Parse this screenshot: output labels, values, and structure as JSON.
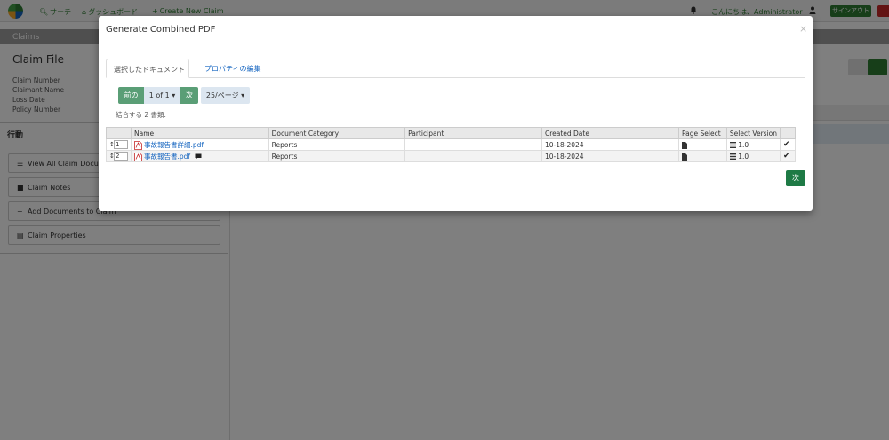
{
  "navbar": {
    "search": "サーチ",
    "dashboard": "ダッシュボード",
    "create_claim": "Create New Claim",
    "greeting": "こんにちは、Administrator",
    "signout": "サインアウト"
  },
  "page": {
    "section_title": "Claims",
    "claim_file_title": "Claim File",
    "fields": [
      "Claim Number",
      "Claimant Name",
      "Loss Date",
      "Policy Number"
    ],
    "actions_title": "行動",
    "actions": [
      {
        "label": "View All Claim Documents",
        "icon": "list-icon"
      },
      {
        "label": "Claim Notes",
        "icon": "comment-icon"
      },
      {
        "label": "Add Documents to Claim",
        "icon": "plus-icon"
      },
      {
        "label": "Claim Properties",
        "icon": "table-icon"
      }
    ]
  },
  "modal": {
    "title": "Generate Combined PDF",
    "close": "×",
    "tabs": [
      "選択したドキュメント",
      "プロパティの編集"
    ],
    "pager": {
      "prev": "前の",
      "count": "1 of 1",
      "next": "次",
      "page_size": "25/ページ"
    },
    "combine_note": "結合する 2 書類.",
    "table": {
      "columns": [
        "Name",
        "Document Category",
        "Participant",
        "Created Date",
        "Page Select",
        "Select Version"
      ],
      "rows": [
        {
          "order": "1",
          "name": "事故報告書詳細.pdf",
          "category": "Reports",
          "participant": "",
          "created": "10-18-2024",
          "version": "1.0",
          "has_comment": false
        },
        {
          "order": "2",
          "name": "事故報告書.pdf",
          "category": "Reports",
          "participant": "",
          "created": "10-18-2024",
          "version": "1.0",
          "has_comment": true
        }
      ]
    },
    "next_button": "次"
  },
  "colors": {
    "brand_green": "#2e7d32",
    "link_blue": "#1565c0",
    "pager_green": "#5a9e76"
  }
}
